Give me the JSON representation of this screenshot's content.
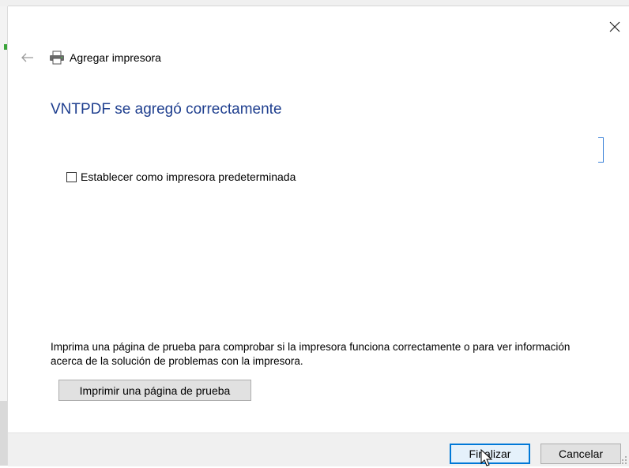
{
  "window": {
    "title": "Agregar impresora",
    "close_icon": "close-icon",
    "back_icon": "back-arrow-icon",
    "printer_icon": "printer-icon"
  },
  "main": {
    "heading": "VNTPDF se agregó correctamente",
    "default_checkbox": {
      "label": "Establecer como impresora predeterminada",
      "checked": false
    },
    "info_text": "Imprima una página de prueba para comprobar si la impresora funciona correctamente o para ver información acerca de la solución de problemas con la impresora.",
    "test_page_button": "Imprimir una página de prueba"
  },
  "footer": {
    "finish_button": "Finalizar",
    "cancel_button": "Cancelar"
  },
  "colors": {
    "heading": "#1f3f8f",
    "focus": "#0078d7",
    "button_bg": "#e1e1e1",
    "footer_bg": "#f0f0f0"
  }
}
